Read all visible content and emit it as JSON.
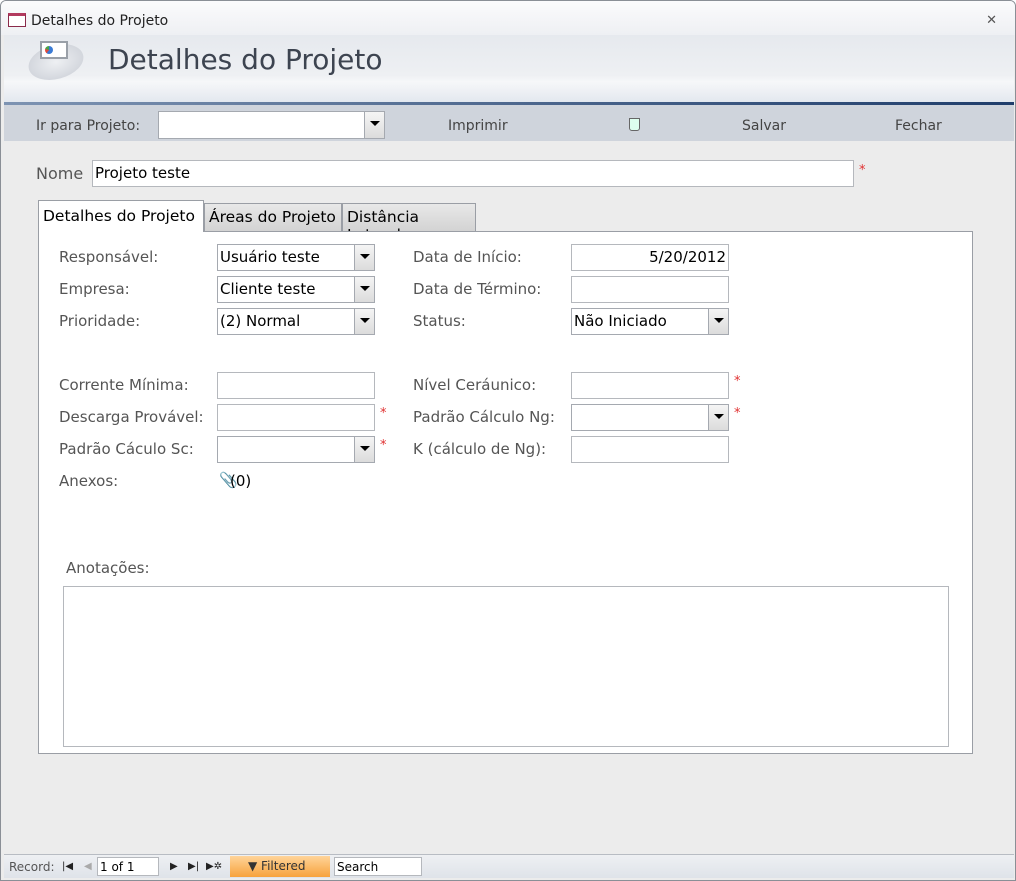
{
  "window": {
    "title": "Detalhes do Projeto",
    "close": "✕"
  },
  "header": {
    "title": "Detalhes do Projeto"
  },
  "toolbar": {
    "goto_label": "Ir para Projeto:",
    "goto_value": "",
    "print": "Imprimir",
    "save": "Salvar",
    "close": "Fechar"
  },
  "form": {
    "name_label": "Nome",
    "name_value": "Projeto teste",
    "required": "*"
  },
  "tabs": [
    "Detalhes do Projeto",
    "Áreas do Projeto",
    "Distância Lateral"
  ],
  "fields": {
    "responsavel": {
      "label": "Responsável:",
      "value": "Usuário teste"
    },
    "empresa": {
      "label": "Empresa:",
      "value": "Cliente teste"
    },
    "prioridade": {
      "label": "Prioridade:",
      "value": "(2) Normal"
    },
    "data_inicio": {
      "label": "Data de Início:",
      "value": "5/20/2012"
    },
    "data_termino": {
      "label": "Data de Término:",
      "value": ""
    },
    "status": {
      "label": "Status:",
      "value": "Não Iniciado"
    },
    "corrente": {
      "label": "Corrente Mínima:",
      "value": ""
    },
    "descarga": {
      "label": "Descarga Provável:",
      "value": ""
    },
    "padrao_sc": {
      "label": "Padrão Cáculo Sc:",
      "value": ""
    },
    "nivel": {
      "label": "Nível Ceráunico:",
      "value": ""
    },
    "padrao_ng": {
      "label": "Padrão Cálculo Ng:",
      "value": ""
    },
    "k": {
      "label": "K (cálculo de Ng):",
      "value": ""
    },
    "anexos": {
      "label": "Anexos:",
      "value": "(0)"
    },
    "anotacoes": {
      "label": "Anotações:",
      "value": ""
    }
  },
  "statusbar": {
    "record_label": "Record:",
    "record_value": "1 of 1",
    "filtered": "Filtered",
    "search": "Search"
  }
}
